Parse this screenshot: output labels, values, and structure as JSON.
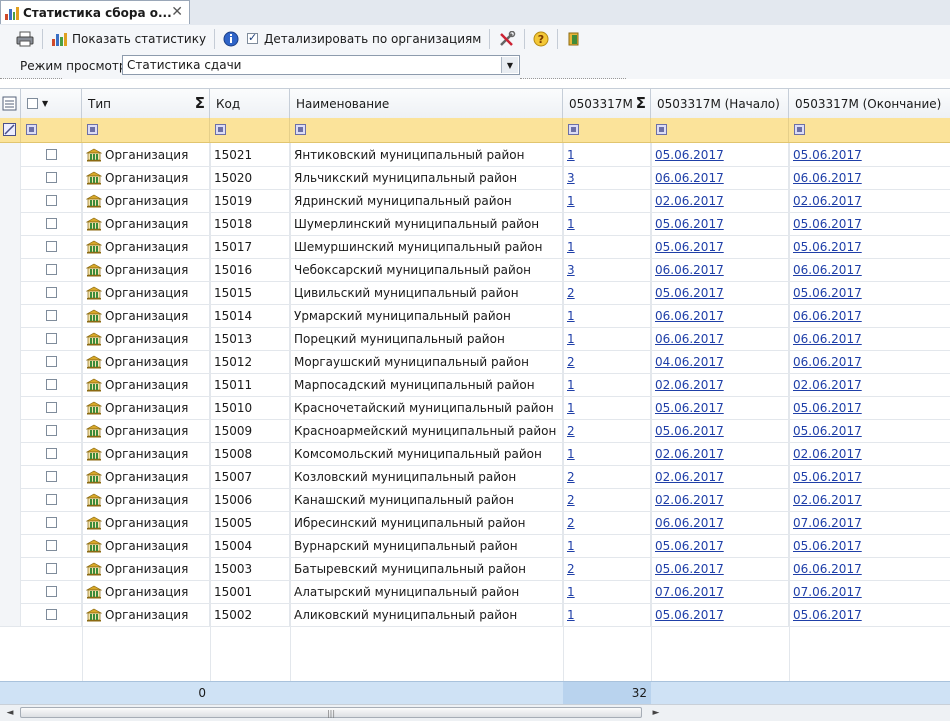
{
  "tab": {
    "title": "Статистика сбора о...",
    "close": "✕"
  },
  "toolbar": {
    "show_stats": "Показать статистику",
    "detail_by_orgs": "Детализировать по организациям",
    "detail_checked": true
  },
  "mode": {
    "label": "Режим просмотра",
    "value": "Статистика сдачи"
  },
  "columns": {
    "type": "Тип",
    "code": "Код",
    "name": "Наименование",
    "count": "0503317М",
    "start": "0503317М  (Начало)",
    "end": "0503317М  (Окончание)"
  },
  "rows": [
    {
      "type": "Организация",
      "code": "15021",
      "name": "Янтиковский муниципальный район",
      "count": "1",
      "start": "05.06.2017",
      "end": "05.06.2017"
    },
    {
      "type": "Организация",
      "code": "15020",
      "name": "Яльчикский муниципальный район",
      "count": "3",
      "start": "06.06.2017",
      "end": "06.06.2017"
    },
    {
      "type": "Организация",
      "code": "15019",
      "name": "Ядринский муниципальный район",
      "count": "1",
      "start": "02.06.2017",
      "end": "02.06.2017"
    },
    {
      "type": "Организация",
      "code": "15018",
      "name": "Шумерлинский муниципальный район",
      "count": "1",
      "start": "05.06.2017",
      "end": "05.06.2017"
    },
    {
      "type": "Организация",
      "code": "15017",
      "name": "Шемуршинский муниципальный район",
      "count": "1",
      "start": "05.06.2017",
      "end": "05.06.2017"
    },
    {
      "type": "Организация",
      "code": "15016",
      "name": "Чебоксарский муниципальный район",
      "count": "3",
      "start": "06.06.2017",
      "end": "06.06.2017"
    },
    {
      "type": "Организация",
      "code": "15015",
      "name": "Цивильский муниципальный район",
      "count": "2",
      "start": "05.06.2017",
      "end": "05.06.2017"
    },
    {
      "type": "Организация",
      "code": "15014",
      "name": "Урмарский муниципальный район",
      "count": "1",
      "start": "06.06.2017",
      "end": "06.06.2017"
    },
    {
      "type": "Организация",
      "code": "15013",
      "name": "Порецкий муниципальный район",
      "count": "1",
      "start": "06.06.2017",
      "end": "06.06.2017"
    },
    {
      "type": "Организация",
      "code": "15012",
      "name": "Моргаушский муниципальный район",
      "count": "2",
      "start": "04.06.2017",
      "end": "06.06.2017"
    },
    {
      "type": "Организация",
      "code": "15011",
      "name": "Марпосадский муниципальный район",
      "count": "1",
      "start": "02.06.2017",
      "end": "02.06.2017"
    },
    {
      "type": "Организация",
      "code": "15010",
      "name": "Красночетайский муниципальный район",
      "count": "1",
      "start": "05.06.2017",
      "end": "05.06.2017"
    },
    {
      "type": "Организация",
      "code": "15009",
      "name": "Красноармейский муниципальный район",
      "count": "2",
      "start": "05.06.2017",
      "end": "05.06.2017"
    },
    {
      "type": "Организация",
      "code": "15008",
      "name": "Комсомольский муниципальный район",
      "count": "1",
      "start": "02.06.2017",
      "end": "02.06.2017"
    },
    {
      "type": "Организация",
      "code": "15007",
      "name": "Козловский муниципальный район",
      "count": "2",
      "start": "02.06.2017",
      "end": "05.06.2017"
    },
    {
      "type": "Организация",
      "code": "15006",
      "name": "Канашский муниципальный район",
      "count": "2",
      "start": "02.06.2017",
      "end": "02.06.2017"
    },
    {
      "type": "Организация",
      "code": "15005",
      "name": "Ибресинский муниципальный район",
      "count": "2",
      "start": "06.06.2017",
      "end": "07.06.2017"
    },
    {
      "type": "Организация",
      "code": "15004",
      "name": "Вурнарский муниципальный район",
      "count": "1",
      "start": "05.06.2017",
      "end": "05.06.2017"
    },
    {
      "type": "Организация",
      "code": "15003",
      "name": "Батыревский муниципальный район",
      "count": "2",
      "start": "05.06.2017",
      "end": "06.06.2017"
    },
    {
      "type": "Организация",
      "code": "15001",
      "name": "Алатырский муниципальный район",
      "count": "1",
      "start": "07.06.2017",
      "end": "07.06.2017"
    },
    {
      "type": "Организация",
      "code": "15002",
      "name": "Аликовский муниципальный район",
      "count": "1",
      "start": "05.06.2017",
      "end": "05.06.2017"
    }
  ],
  "footer": {
    "type_sum": "0",
    "count_sum": "32"
  },
  "scroll": {
    "left": "◄",
    "right": "►",
    "grip": "|||"
  }
}
